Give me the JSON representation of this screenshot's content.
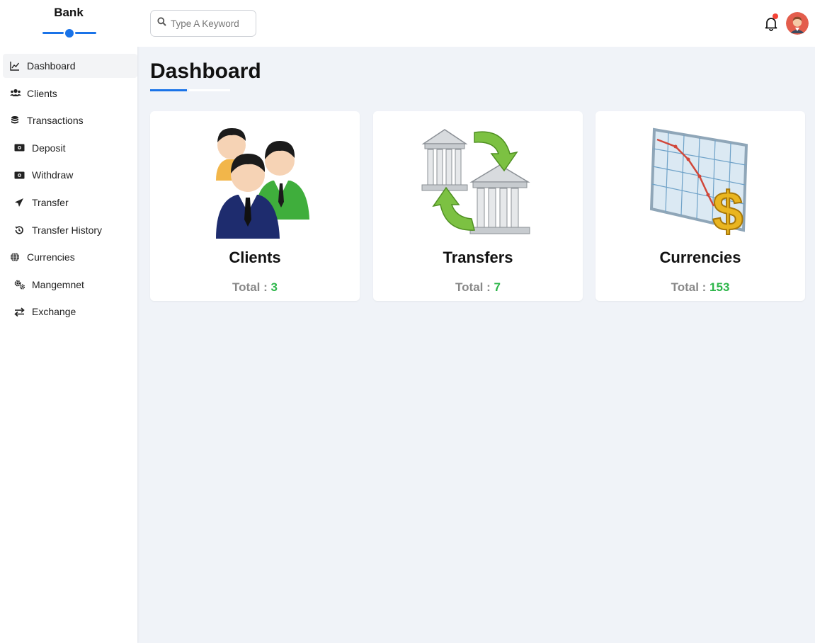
{
  "brand": {
    "name": "Bank",
    "accent": "#1a73e8"
  },
  "sidebar": {
    "items": [
      {
        "label": "Dashboard",
        "icon": "chart-line-icon",
        "active": true,
        "sub": false
      },
      {
        "label": "Clients",
        "icon": "users-icon",
        "active": false,
        "sub": false
      },
      {
        "label": "Transactions",
        "icon": "coins-icon",
        "active": false,
        "sub": false
      },
      {
        "label": "Deposit",
        "icon": "money-bill-icon",
        "active": false,
        "sub": true
      },
      {
        "label": "Withdraw",
        "icon": "money-bill-icon",
        "active": false,
        "sub": true
      },
      {
        "label": "Transfer",
        "icon": "paper-plane-icon",
        "active": false,
        "sub": true
      },
      {
        "label": "Transfer History",
        "icon": "history-icon",
        "active": false,
        "sub": true
      },
      {
        "label": "Currencies",
        "icon": "globe-icon",
        "active": false,
        "sub": false
      },
      {
        "label": "Mangemnet",
        "icon": "gears-icon",
        "active": false,
        "sub": true
      },
      {
        "label": "Exchange",
        "icon": "exchange-arrows-icon",
        "active": false,
        "sub": true
      }
    ]
  },
  "topbar": {
    "search_placeholder": "Type A Keyword",
    "notification_badge_color": "#f44336"
  },
  "main": {
    "title": "Dashboard",
    "cards": [
      {
        "title": "Clients",
        "total_label": "Total :",
        "total_value": "3",
        "icon": "people-group-icon"
      },
      {
        "title": "Transfers",
        "total_label": "Total :",
        "total_value": "7",
        "icon": "bank-transfer-icon"
      },
      {
        "title": "Currencies",
        "total_label": "Total :",
        "total_value": "153",
        "icon": "currency-chart-icon"
      }
    ],
    "total_value_color": "#2db64a"
  }
}
